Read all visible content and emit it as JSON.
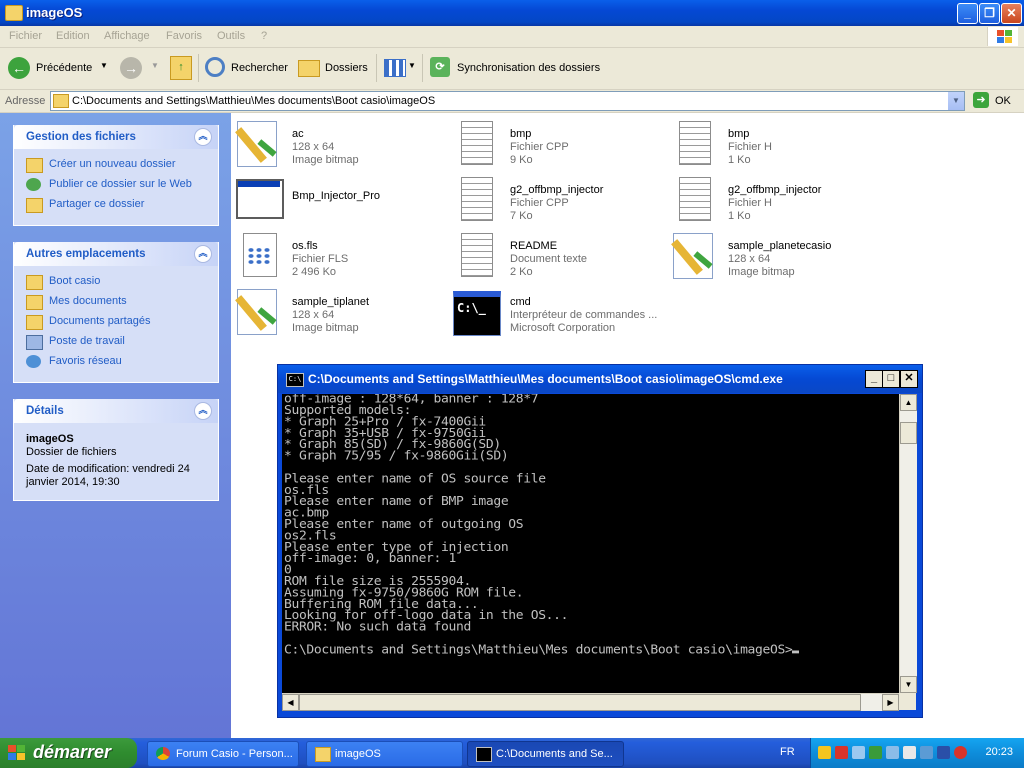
{
  "window": {
    "title": "imageOS"
  },
  "menu": [
    "Fichier",
    "Edition",
    "Affichage",
    "Favoris",
    "Outils",
    "?"
  ],
  "toolbar": {
    "back": "Précédente",
    "search": "Rechercher",
    "folders": "Dossiers",
    "sync": "Synchronisation des dossiers"
  },
  "address": {
    "label": "Adresse",
    "path": "C:\\Documents and Settings\\Matthieu\\Mes documents\\Boot casio\\imageOS",
    "go": "OK"
  },
  "tasks": {
    "title": "Gestion des fichiers",
    "items": [
      "Créer un nouveau dossier",
      "Publier ce dossier sur le Web",
      "Partager ce dossier"
    ]
  },
  "places": {
    "title": "Autres emplacements",
    "items": [
      "Boot casio",
      "Mes documents",
      "Documents partagés",
      "Poste de travail",
      "Favoris réseau"
    ]
  },
  "details": {
    "title": "Détails",
    "name": "imageOS",
    "type": "Dossier de fichiers",
    "modified": "Date de modification: vendredi 24 janvier 2014, 19:30"
  },
  "files": [
    {
      "name": "ac",
      "l2": "128 x 64",
      "l3": "Image bitmap",
      "icon": "bitmap-icon"
    },
    {
      "name": "bmp",
      "l2": "Fichier CPP",
      "l3": "9 Ko",
      "icon": "document-icon"
    },
    {
      "name": "bmp",
      "l2": "Fichier H",
      "l3": "1 Ko",
      "icon": "document-icon"
    },
    {
      "name": "Bmp_Injector_Pro",
      "l2": "",
      "l3": "",
      "icon": "application-icon"
    },
    {
      "name": "g2_offbmp_injector",
      "l2": "Fichier CPP",
      "l3": "7 Ko",
      "icon": "document-icon"
    },
    {
      "name": "g2_offbmp_injector",
      "l2": "Fichier H",
      "l3": "1 Ko",
      "icon": "document-icon"
    },
    {
      "name": "os.fls",
      "l2": "Fichier FLS",
      "l3": "2 496 Ko",
      "icon": "fls-file-icon"
    },
    {
      "name": "README",
      "l2": "Document texte",
      "l3": "2 Ko",
      "icon": "document-icon"
    },
    {
      "name": "sample_planetecasio",
      "l2": "128 x 64",
      "l3": "Image bitmap",
      "icon": "bitmap-icon"
    },
    {
      "name": "sample_tiplanet",
      "l2": "128 x 64",
      "l3": "Image bitmap",
      "icon": "bitmap-icon"
    },
    {
      "name": "cmd",
      "l2": "Interpréteur de commandes ...",
      "l3": "Microsoft Corporation",
      "icon": "cmd-icon"
    }
  ],
  "cmd": {
    "title": "C:\\Documents and Settings\\Matthieu\\Mes documents\\Boot casio\\imageOS\\cmd.exe",
    "icon_text": "C:\\",
    "output": "off-image : 128*64, banner : 128*7\nSupported models:\n* Graph 25+Pro / fx-7400Gii\n* Graph 35+USB / fx-9750Gii\n* Graph 85(SD) / fx-9860G(SD)\n* Graph 75/95 / fx-9860Gii(SD)\n\nPlease enter name of OS source file\nos.fls\nPlease enter name of BMP image\nac.bmp\nPlease enter name of outgoing OS\nos2.fls\nPlease enter type of injection\noff-image: 0, banner: 1\n0\nROM file size is 2555904.\nAssuming fx-9750/9860G ROM file.\nBuffering ROM file data...\nLooking for off-logo data in the OS...\nERROR: No such data found\n\nC:\\Documents and Settings\\Matthieu\\Mes documents\\Boot casio\\imageOS>"
  },
  "taskbar": {
    "start": "démarrer",
    "tasks": [
      "Forum Casio - Person...",
      "imageOS",
      "C:\\Documents and Se..."
    ],
    "lang": "FR",
    "clock": "20:23"
  },
  "colors": {
    "xp_blue": "#0A5FEA",
    "panel_link": "#215DC6",
    "start_green": "#3C9A3C"
  }
}
